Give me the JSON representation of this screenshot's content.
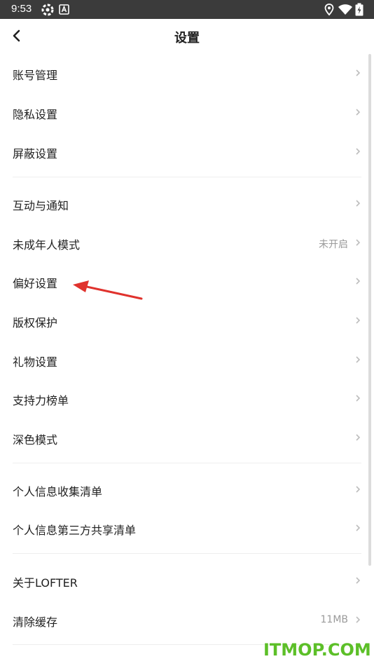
{
  "status_bar": {
    "time": "9:53",
    "icons": [
      "settings-gear-icon",
      "a-notification-icon",
      "location-icon",
      "wifi-icon",
      "battery-charging-icon"
    ]
  },
  "header": {
    "title": "设置",
    "back_icon": "chevron-left-icon"
  },
  "menu": {
    "group1": [
      {
        "label": "账号管理"
      },
      {
        "label": "隐私设置"
      },
      {
        "label": "屏蔽设置"
      }
    ],
    "group2": [
      {
        "label": "互动与通知"
      },
      {
        "label": "未成年人模式",
        "value": "未开启"
      },
      {
        "label": "偏好设置"
      },
      {
        "label": "版权保护"
      },
      {
        "label": "礼物设置"
      },
      {
        "label": "支持力榜单"
      },
      {
        "label": "深色模式"
      }
    ],
    "group3": [
      {
        "label": "个人信息收集清单"
      },
      {
        "label": "个人信息第三方共享清单"
      }
    ],
    "group4": [
      {
        "label": "关于LOFTER"
      },
      {
        "label": "清除缓存",
        "value": "11MB"
      }
    ]
  },
  "annotation": {
    "icon": "red-arrow-icon",
    "color": "#e0322d"
  },
  "watermark": {
    "text": "ITMOP.COM",
    "color": "#5cbf28"
  }
}
